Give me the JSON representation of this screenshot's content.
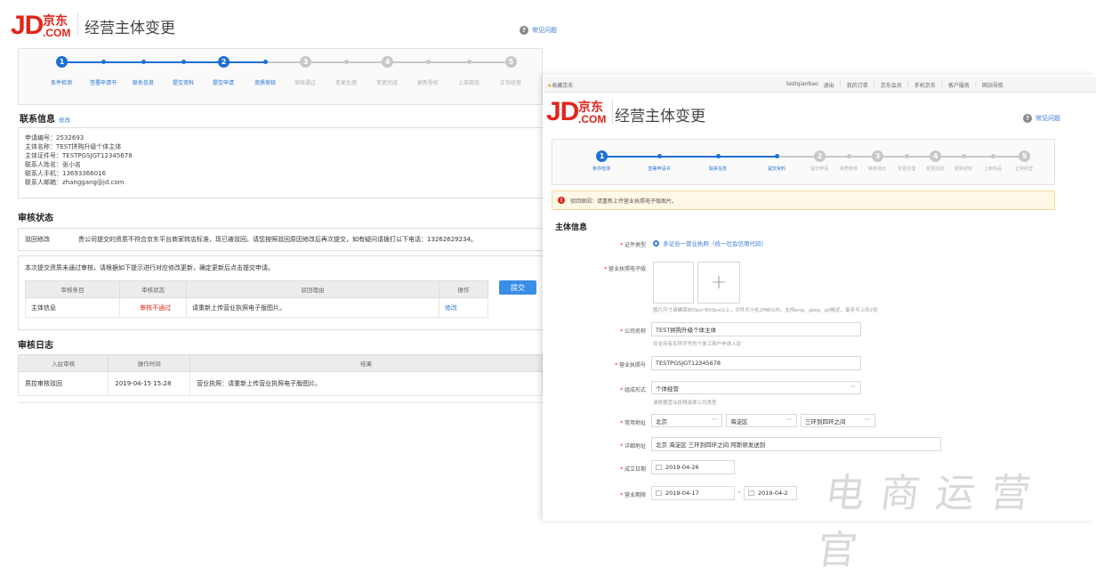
{
  "left": {
    "logo": {
      "jd": "JD",
      "cn": "京东",
      "com": ".COM"
    },
    "title": "经营主体变更",
    "faq": "常见问题",
    "steps": {
      "numbers": [
        "1",
        "2",
        "3",
        "4",
        "5"
      ],
      "labels": [
        "条件检测",
        "签署申请书",
        "联系信息",
        "提交资料",
        "提交申请",
        "资质审核",
        "审核通过",
        "变更处理",
        "变更完成",
        "更新授权",
        "上架商品",
        "正常经营"
      ]
    },
    "contact": {
      "heading": "联系信息",
      "edit": "修改",
      "lines": [
        "申请编号：2532693",
        "主体名称：TEST拼购升级个体主体",
        "主体证件号：TESTPGSJGT12345678",
        "联系人姓名：张小名",
        "联系人手机：13693366016",
        "联系人邮箱：zhanggang@jd.com"
      ]
    },
    "audit": {
      "heading": "审核状态",
      "status_label": "驳回修改",
      "status_text": "贵公司提交的资质不符合京东平台商家转店标准，现已被驳回。请您按照驳回原因修改后再次提交，如有疑问请拨打以下电话：13262629234。",
      "instruction": "本次提交资质未通过审核，请根据如下提示进行对应修改更新，确定更新后点击提交申请。",
      "submit": "提交",
      "columns": [
        "审核条目",
        "审核状态",
        "驳回理由",
        "操作"
      ],
      "rows": [
        {
          "item": "主体信息",
          "status": "审核不通过",
          "reason": "请重新上传营业执照电子版图片。",
          "action": "修改"
        }
      ]
    },
    "log": {
      "heading": "审核日志",
      "columns": [
        "入驻审核",
        "操作时间",
        "结果"
      ],
      "rows": [
        {
          "stage": "质控审核驳回",
          "time": "2019-04-15 15:28",
          "result": "营业执照：请重新上传营业执照电子版图片。"
        }
      ]
    }
  },
  "right": {
    "topbar": {
      "favorite": "收藏京东",
      "links": [
        "testqianbao",
        "退出",
        "我的订单",
        "京东会员",
        "手机京东",
        "客户服务",
        "网站导航"
      ]
    },
    "title": "经营主体变更",
    "faq": "常见问题",
    "steps": {
      "numbers": [
        "1",
        "2",
        "3",
        "4",
        "5"
      ],
      "labels": [
        "条件检测",
        "签署申请书",
        "联系信息",
        "提交资料",
        "提交申请",
        "资质审核",
        "审核通过",
        "变更处理",
        "变更完成",
        "更新授权",
        "上架商品",
        "正常经营"
      ]
    },
    "alert": "驳回原因：请重新上传营业执照电子版图片。",
    "section": "主体信息",
    "form": {
      "cert_type_label": "证件类型",
      "cert_type_value": "多证合一营业执照（统一社会信用代码）",
      "license_label": "营业执照电子版",
      "upload_plus": "+",
      "license_hint": "图片尺寸请确保800px*800px以上，文件大小在2MB以内，支持png、jpeg、gif格式，最多可上传2张",
      "company_label": "公司名称",
      "company_value": "TEST拼购升级个体主体",
      "company_hint": "仅支持有名称字号的个体工商户申请入驻",
      "license_no_label": "营业执照号",
      "license_no_value": "TESTPGSJGT12345678",
      "org_label": "组成形式",
      "org_value": "个体经营",
      "org_hint": "请根据营业执照选择公司类型",
      "addr_label": "常用地址",
      "addr_city": "北京",
      "addr_district": "海淀区",
      "addr_area": "三环到四环之间",
      "detail_label": "详细地址",
      "detail_value": "北京 海淀区 三环到四环之间 阿斯顿发送到",
      "founded_label": "成立日期",
      "founded_value": "2019-04-26",
      "term_label": "营业期限",
      "term_start": "2019-04-17",
      "term_sep": "-",
      "term_end": "2019-04-2"
    },
    "watermark": "电商运营官"
  },
  "colors": {
    "brand": "#e1251b",
    "accent": "#3a7bd5",
    "done": "#1f6fd1",
    "inactive": "#c8c8c8"
  }
}
